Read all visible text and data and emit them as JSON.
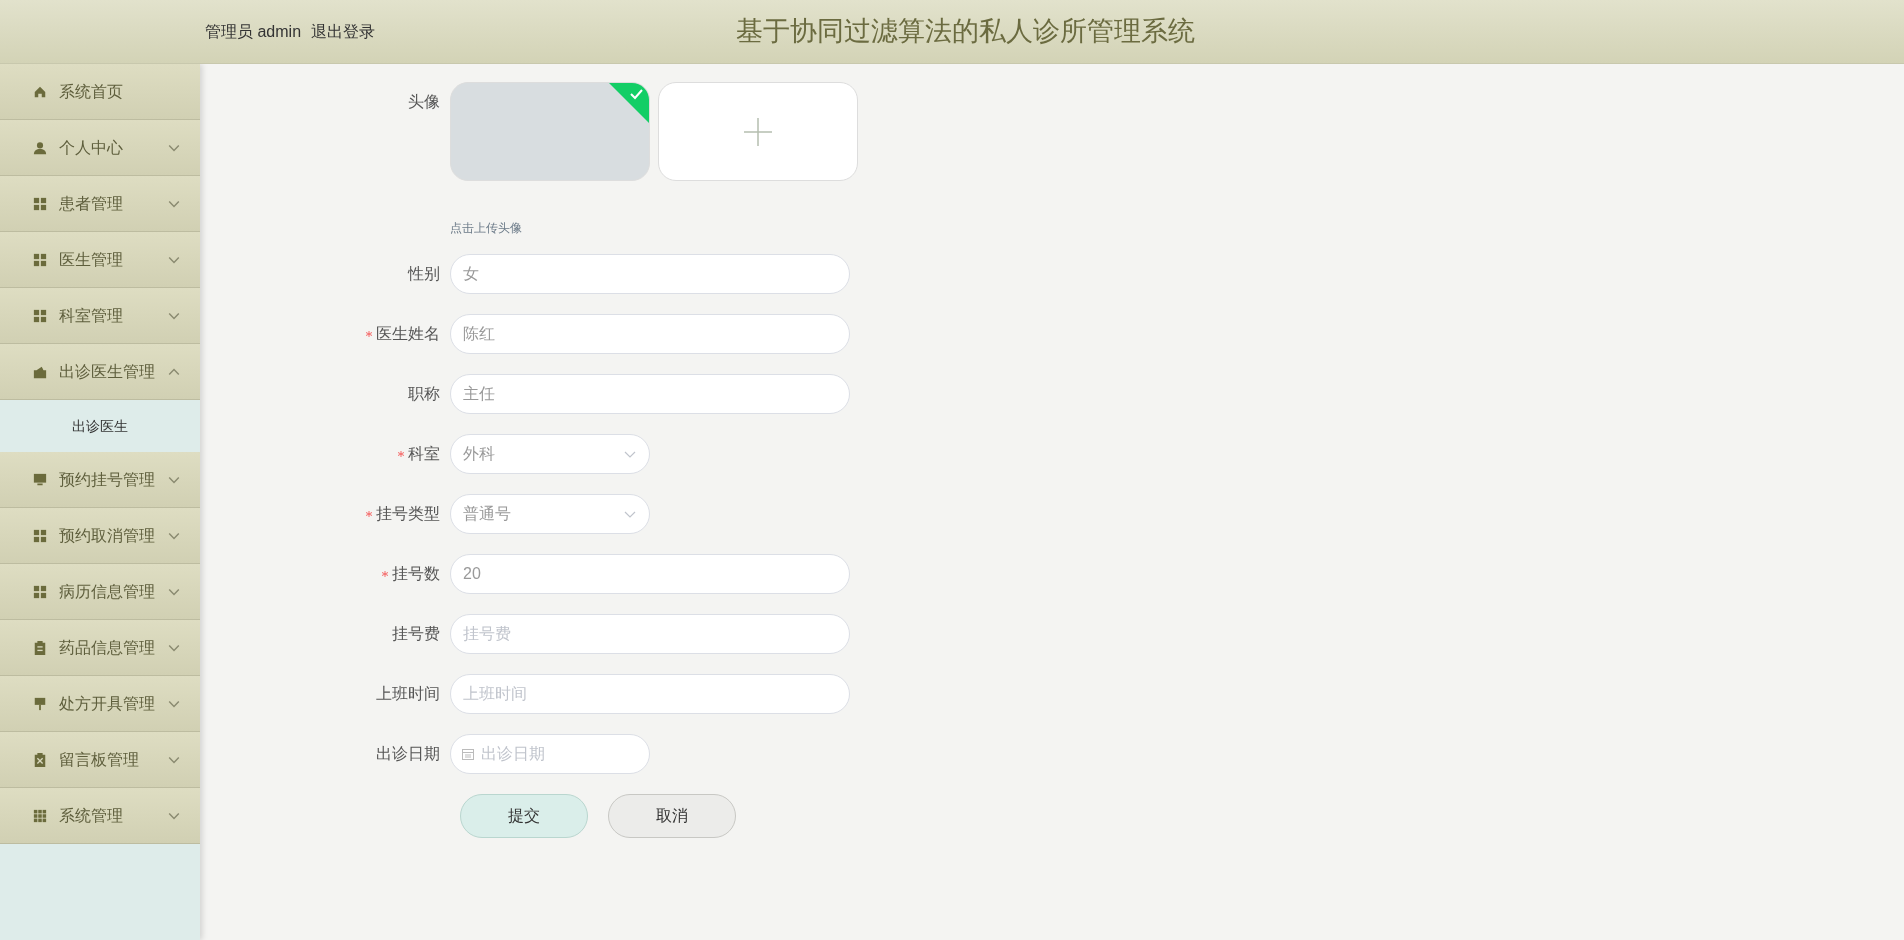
{
  "header": {
    "user": "管理员 admin",
    "logout": "退出登录",
    "title": "基于协同过滤算法的私人诊所管理系统"
  },
  "sidebar": {
    "items": [
      {
        "kind": "link",
        "label": "系统首页"
      },
      {
        "kind": "menu",
        "label": "个人中心",
        "expanded": false
      },
      {
        "kind": "menu",
        "label": "患者管理",
        "expanded": false
      },
      {
        "kind": "menu",
        "label": "医生管理",
        "expanded": false
      },
      {
        "kind": "menu",
        "label": "科室管理",
        "expanded": false
      },
      {
        "kind": "menu",
        "label": "出诊医生管理",
        "expanded": true,
        "children": [
          {
            "label": "出诊医生"
          }
        ]
      },
      {
        "kind": "menu",
        "label": "预约挂号管理",
        "expanded": false
      },
      {
        "kind": "menu",
        "label": "预约取消管理",
        "expanded": false
      },
      {
        "kind": "menu",
        "label": "病历信息管理",
        "expanded": false
      },
      {
        "kind": "menu",
        "label": "药品信息管理",
        "expanded": false
      },
      {
        "kind": "menu",
        "label": "处方开具管理",
        "expanded": false
      },
      {
        "kind": "menu",
        "label": "留言板管理",
        "expanded": false
      },
      {
        "kind": "menu",
        "label": "系统管理",
        "expanded": false
      }
    ]
  },
  "form": {
    "avatar": {
      "label": "头像",
      "uploaded": true,
      "tip": "点击上传头像"
    },
    "fields": [
      {
        "kind": "input",
        "label": "性别",
        "required": false,
        "value": "女"
      },
      {
        "kind": "input",
        "label": "医生姓名",
        "required": true,
        "value": "陈红"
      },
      {
        "kind": "input",
        "label": "职称",
        "required": false,
        "value": "主任"
      },
      {
        "kind": "select",
        "label": "科室",
        "required": true,
        "value": "外科"
      },
      {
        "kind": "select",
        "label": "挂号类型",
        "required": true,
        "value": "普通号"
      },
      {
        "kind": "input",
        "label": "挂号数",
        "required": true,
        "value": "20"
      },
      {
        "kind": "input",
        "label": "挂号费",
        "required": false,
        "placeholder": "挂号费"
      },
      {
        "kind": "input",
        "label": "上班时间",
        "required": false,
        "placeholder": "上班时间"
      },
      {
        "kind": "date",
        "label": "出诊日期",
        "required": false,
        "placeholder": "出诊日期"
      }
    ],
    "buttons": {
      "submit": "提交",
      "cancel": "取消"
    }
  }
}
